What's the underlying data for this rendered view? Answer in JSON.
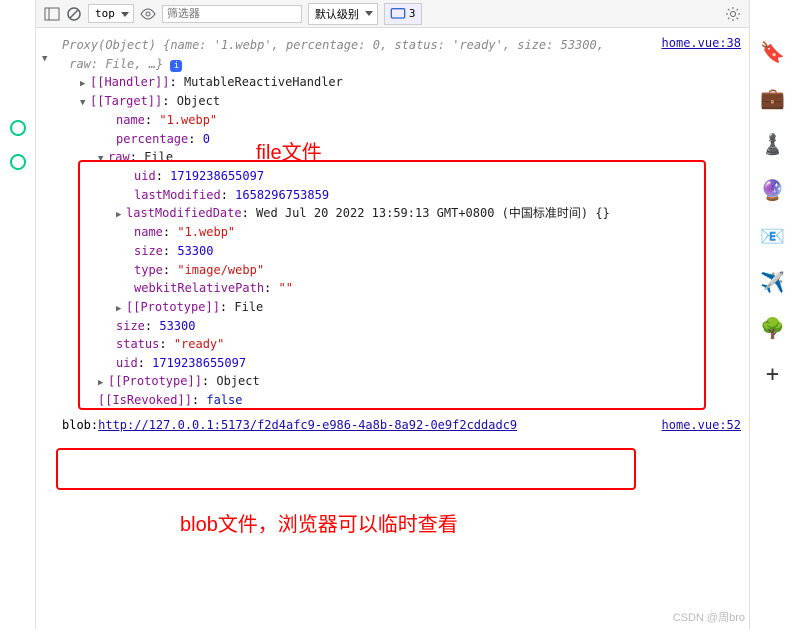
{
  "toolbar": {
    "context": "top",
    "filter_placeholder": "筛选器",
    "level": "默认级别",
    "msg_count": "3"
  },
  "source1": "home.vue:38",
  "source2": "home.vue:52",
  "proxy_summary": {
    "head": "Proxy(Object)",
    "brace_open": "{",
    "k_name": "name:",
    "v_name": "'1.webp'",
    "k_perc": "percentage:",
    "v_perc": "0",
    "k_status": "status:",
    "v_status": "'ready'",
    "k_size": "size:",
    "v_size": "53300",
    "k_raw": "raw:",
    "v_raw": "File",
    "ell": ", …}"
  },
  "handler": {
    "label": "[[Handler]]",
    "value": "MutableReactiveHandler"
  },
  "target": {
    "label": "[[Target]]",
    "value": "Object"
  },
  "target_props": {
    "name_k": "name",
    "name_v": "\"1.webp\"",
    "perc_k": "percentage",
    "perc_v": "0",
    "raw_k": "raw",
    "raw_v": "File",
    "size_k": "size",
    "size_v": "53300",
    "status_k": "status",
    "status_v": "\"ready\"",
    "uid_k": "uid",
    "uid_v": "1719238655097"
  },
  "raw_props": {
    "uid_k": "uid",
    "uid_v": "1719238655097",
    "lm_k": "lastModified",
    "lm_v": "1658296753859",
    "lmd_k": "lastModifiedDate",
    "lmd_v": "Wed Jul 20 2022 13:59:13 GMT+0800 (中国标准时间)",
    "lmd_tail": " {}",
    "name_k": "name",
    "name_v": "\"1.webp\"",
    "size_k": "size",
    "size_v": "53300",
    "type_k": "type",
    "type_v": "\"image/webp\"",
    "wrp_k": "webkitRelativePath",
    "wrp_v": "\"\""
  },
  "proto_file": {
    "label": "[[Prototype]]",
    "value": "File"
  },
  "proto_obj": {
    "label": "[[Prototype]]",
    "value": "Object"
  },
  "revoked": {
    "label": "[[IsRevoked]]",
    "value": "false"
  },
  "blob": {
    "prefix": "blob:",
    "url": "http://127.0.0.1:5173/f2d4afc9-e986-4a8b-8a92-0e9f2cddadc9"
  },
  "annotations": {
    "file_label": "file文件",
    "blob_label": "blob文件，浏览器可以临时查看"
  },
  "watermark": "CSDN @周bro"
}
